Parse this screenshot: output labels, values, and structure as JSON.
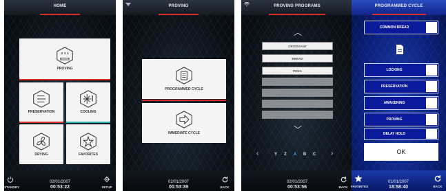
{
  "panel1": {
    "title": "HOME",
    "tiles": {
      "proving": "PROVING",
      "preservation": "PRESERVATION",
      "cooling": "COOLING",
      "drying": "DRYING",
      "favorites": "FAVORITES"
    },
    "footer": {
      "left": "STANDBY",
      "right": "SETUP",
      "date": "02/01/2007",
      "time": "00:53:22"
    }
  },
  "panel2": {
    "title": "PROVING",
    "buttons": {
      "programmed": "PROGRAMMED CYCLE",
      "immediate": "IMMEDIATE CYCLE"
    },
    "footer": {
      "right": "BACK",
      "date": "02/01/2007",
      "time": "00:53:39"
    }
  },
  "panel3": {
    "title": "PROVING PROGRAMS",
    "items": [
      "CROISSANT",
      "BREAD",
      "PIZZA"
    ],
    "alphabet": [
      "Y",
      "Z",
      "A",
      "B",
      "C"
    ],
    "selected_letter": "A",
    "footer": {
      "right": "BACK",
      "date": "02/01/2007",
      "time": "00:53:56"
    }
  },
  "panel4": {
    "title": "PROGRAMMED CYCLE",
    "program": "COMMON BREAD",
    "phases": [
      "LOCKING",
      "PRESERVATION",
      "AWAKENING",
      "PROVING",
      "DELAY HOLD"
    ],
    "ok": "OK",
    "footer": {
      "left": "FAVORITES",
      "right": "BACK",
      "date": "01/01/2007",
      "time": "18:58:40"
    }
  },
  "colors": {
    "accent_red": "#d92a2a",
    "accent_teal": "#21b3a5",
    "accent_blue": "#0a1a9a",
    "highlight_letter": "#4aa0e8"
  }
}
